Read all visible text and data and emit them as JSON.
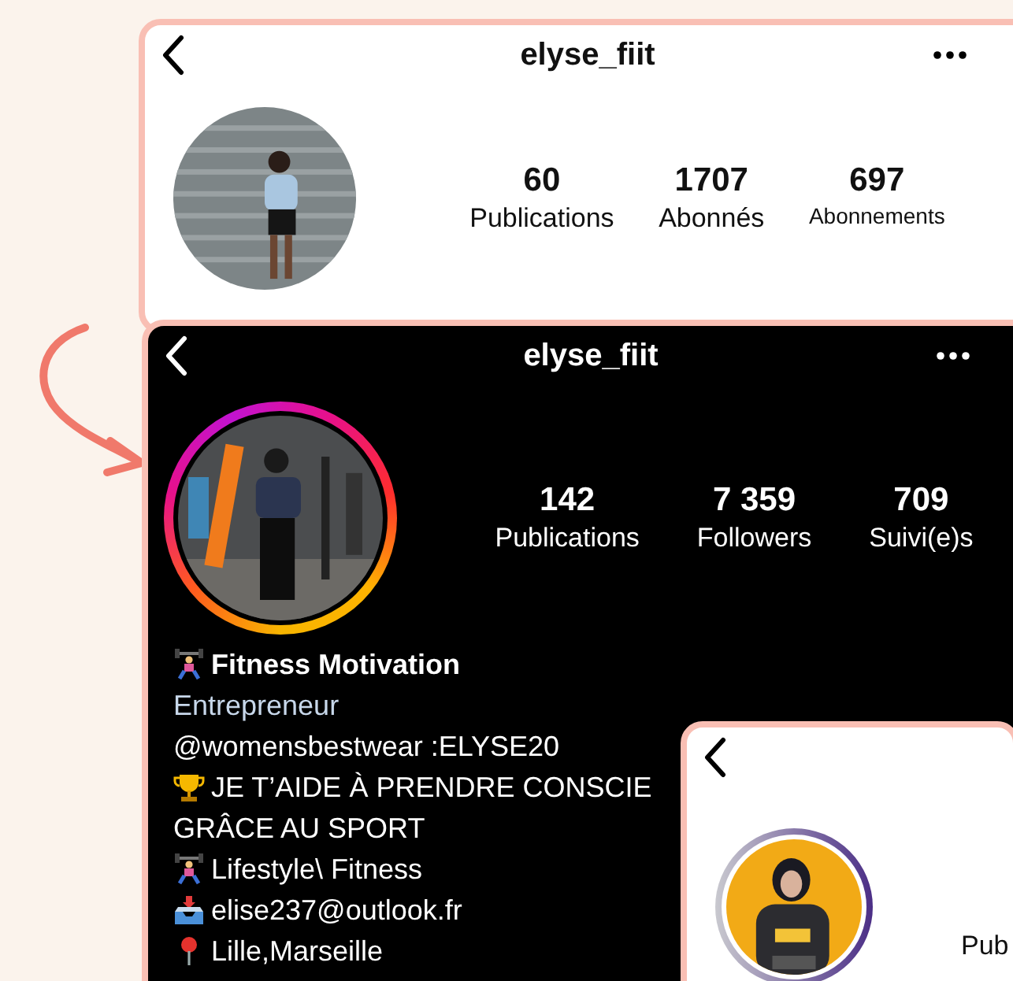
{
  "screens": [
    {
      "dark": false,
      "title": "elyse_fiit",
      "has_menu": true,
      "avatar": {
        "kind": "plain"
      },
      "stats": [
        {
          "value": "60",
          "label": "Publications"
        },
        {
          "value": "1707",
          "label": "Abonnés"
        },
        {
          "value": "697",
          "label": "Abonnements"
        }
      ]
    },
    {
      "dark": true,
      "title": "elyse_fiit",
      "has_menu": true,
      "avatar": {
        "kind": "gradient-ring"
      },
      "stats": [
        {
          "value": "142",
          "label": "Publications"
        },
        {
          "value": "7 359",
          "label": "Followers"
        },
        {
          "value": "709",
          "label": "Suivi(e)s"
        }
      ],
      "bio": [
        {
          "kind": "weightlifter",
          "text": "Fitness Motivation",
          "bold": true
        },
        {
          "kind": "plain",
          "text": "Entrepreneur",
          "muted": true
        },
        {
          "kind": "plain",
          "text": "@womensbestwear :ELYSE20"
        },
        {
          "kind": "trophy",
          "text": "JE T’AIDE À PRENDRE CONSCIE"
        },
        {
          "kind": "plain",
          "text": "GRÂCE AU SPORT"
        },
        {
          "kind": "weightlifter",
          "text": " Lifestyle\\ Fitness"
        },
        {
          "kind": "inbox",
          "text": "elise237@outlook.fr"
        },
        {
          "kind": "pin",
          "text": "Lille,Marseille"
        }
      ]
    },
    {
      "dark": false,
      "has_menu": false,
      "avatar": {
        "kind": "ring"
      },
      "stats": [
        {
          "label": "Pub"
        }
      ]
    }
  ]
}
